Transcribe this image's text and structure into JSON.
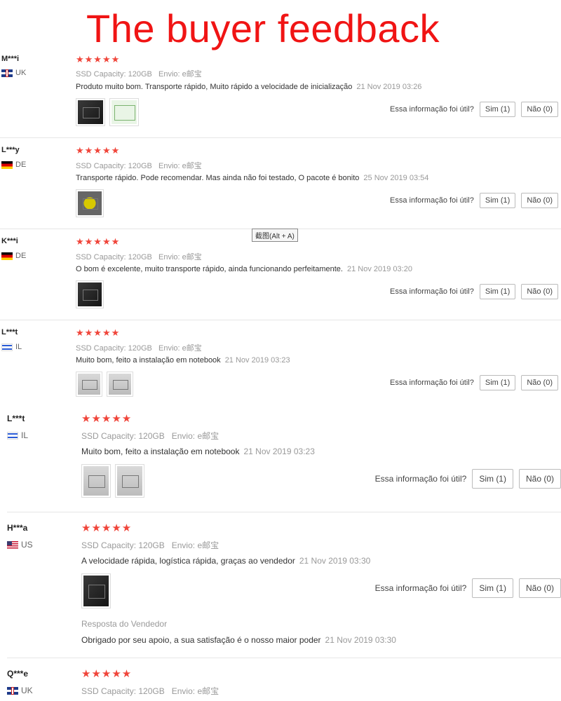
{
  "headline": "The buyer feedback",
  "tooltip": "截图(Alt + A)",
  "attr_labels": {
    "capacity": "SSD Capacity:",
    "shipping": "Envio:"
  },
  "useful": {
    "question": "Essa informação foi útil?",
    "yes": "Sim (1)",
    "no": "Não (0)"
  },
  "reviews": [
    {
      "name": "M***i",
      "country": "UK",
      "stars": "★★★★★",
      "capacity": "120GB",
      "shipping": "e邮宝",
      "text": "Produto muito bom. Transporte rápido, Muito rápido a velocidade de inicialização",
      "date": "21 Nov 2019 03:26"
    },
    {
      "name": "L***y",
      "country": "DE",
      "stars": "★★★★★",
      "capacity": "120GB",
      "shipping": "e邮宝",
      "text": "Transporte rápido. Pode recomendar. Mas ainda não foi testado, O pacote é bonito",
      "date": "25 Nov 2019 03:54"
    },
    {
      "name": "K***i",
      "country": "DE",
      "stars": "★★★★★",
      "capacity": "120GB",
      "shipping": "e邮宝",
      "text": "O bom é excelente, muito transporte rápido, ainda funcionando perfeitamente.",
      "date": "21 Nov 2019 03:20"
    },
    {
      "name": "L***t",
      "country": "IL",
      "stars": "★★★★★",
      "capacity": "120GB",
      "shipping": "e邮宝",
      "text": "Muito bom, feito a instalação em notebook",
      "date": "21 Nov 2019 03:23"
    },
    {
      "name": "L***t",
      "country": "IL",
      "stars": "★★★★★",
      "capacity": "120GB",
      "shipping": "e邮宝",
      "text": "Muito bom, feito a instalação em notebook",
      "date": "21 Nov 2019 03:23"
    },
    {
      "name": "H***a",
      "country": "US",
      "stars": "★★★★★",
      "capacity": "120GB",
      "shipping": "e邮宝",
      "text": "A velocidade rápida, logística rápida, graças ao vendedor",
      "date": "21 Nov 2019 03:30",
      "reply_label": "Resposta do Vendedor",
      "reply_text": "Obrigado por seu apoio, a sua satisfação é o nosso maior poder",
      "reply_date": "21 Nov 2019 03:30"
    },
    {
      "name": "Q***e",
      "country": "UK",
      "stars": "★★★★★",
      "capacity": "120GB",
      "shipping": "e邮宝"
    }
  ]
}
